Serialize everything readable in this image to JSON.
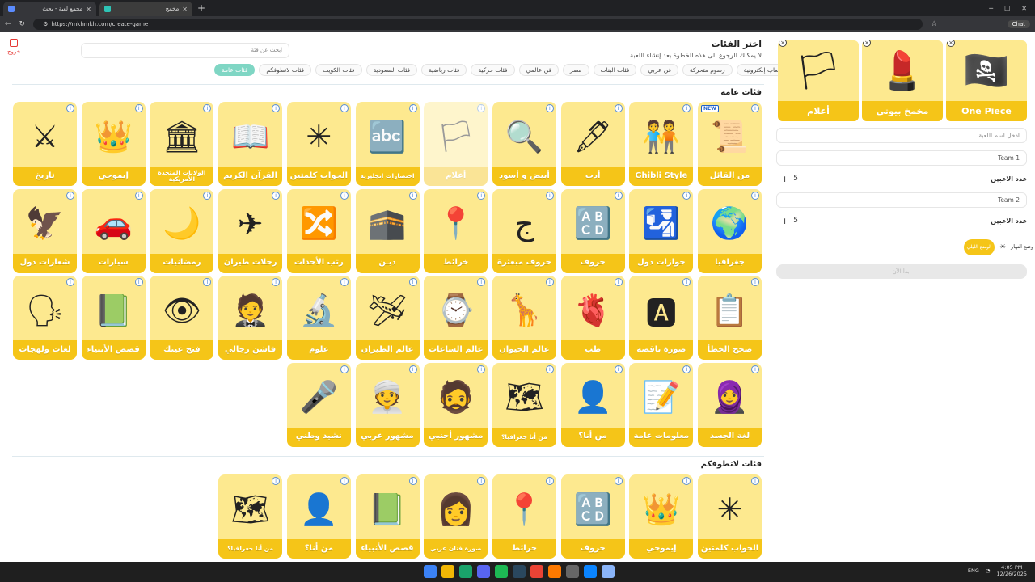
{
  "browser": {
    "tabs": [
      {
        "title": "مجمع لعبة - بحث",
        "active": false
      },
      {
        "title": "مخمخ",
        "active": true
      }
    ],
    "url": "https://mkhmkh.com/create-game",
    "chat_label": "Chat"
  },
  "page": {
    "logout_label": "خروج",
    "search_placeholder": "ابحث عن فئة",
    "heading": "اختر الفئات",
    "subheading": "لا يمكنك الرجوع الى هذه الخطوة بعد إنشاء اللعبة.",
    "chips": [
      {
        "label": "فئات عامة",
        "active": true
      },
      {
        "label": "فئات لاتطوفكم",
        "active": false
      },
      {
        "label": "فئات الكويت",
        "active": false
      },
      {
        "label": "فئات السعودية",
        "active": false
      },
      {
        "label": "فئات رياضية",
        "active": false
      },
      {
        "label": "فئات حركية",
        "active": false
      },
      {
        "label": "فن عالمي",
        "active": false
      },
      {
        "label": "مصر",
        "active": false
      },
      {
        "label": "فئات البنات",
        "active": false
      },
      {
        "label": "فن عربي",
        "active": false
      },
      {
        "label": "رسوم متحركة",
        "active": false
      },
      {
        "label": "العاب إلكترونية",
        "active": false
      }
    ],
    "sections": [
      {
        "title": "فئات عامة",
        "rows": [
          [
            {
              "label": "من القائل",
              "icon": "scroll-icon",
              "glyph": "📜",
              "badge": "NEW"
            },
            {
              "label": "Ghibli Style",
              "icon": "caricature-icon",
              "glyph": "🧑‍🤝‍🧑"
            },
            {
              "label": "أدب",
              "icon": "quill-icon",
              "glyph": "🖋"
            },
            {
              "label": "أبيض و أسود",
              "icon": "magnifier-icon",
              "glyph": "🔍"
            },
            {
              "label": "أعلام",
              "icon": "flags-icon",
              "glyph": "🏳",
              "dim": true
            },
            {
              "label": "اختصارات انجليزية",
              "icon": "letters-icon",
              "glyph": "🔤",
              "small": true
            },
            {
              "label": "الجواب كلمتين",
              "icon": "puzzle-badge-icon",
              "glyph": "✳"
            },
            {
              "label": "القرآن الكريم",
              "icon": "quran-icon",
              "glyph": "📖"
            },
            {
              "label": "الولايات المتحدة الأمريكية",
              "icon": "usa-icon",
              "glyph": "🏛",
              "small": true
            },
            {
              "label": "إيموجي",
              "icon": "emoji-icon",
              "glyph": "👑"
            },
            {
              "label": "تاريخ",
              "icon": "spartan-icon",
              "glyph": "⚔"
            }
          ],
          [
            {
              "label": "جغرافيا",
              "icon": "globe-icon",
              "glyph": "🌍"
            },
            {
              "label": "جوازات دول",
              "icon": "passport-icon",
              "glyph": "🛂"
            },
            {
              "label": "حروف",
              "icon": "letter-grid-icon",
              "glyph": "🔠"
            },
            {
              "label": "حروف مبعثرة",
              "icon": "scattered-letters-icon",
              "glyph": "ج"
            },
            {
              "label": "خرائط",
              "icon": "map-pin-icon",
              "glyph": "📍"
            },
            {
              "label": "ديـن",
              "icon": "kaaba-icon",
              "glyph": "🕋"
            },
            {
              "label": "رتب الأحداث",
              "icon": "sequence-icon",
              "glyph": "🔀"
            },
            {
              "label": "رحلات طيران",
              "icon": "flight-globe-icon",
              "glyph": "✈"
            },
            {
              "label": "رمضانيات",
              "icon": "lantern-icon",
              "glyph": "🌙"
            },
            {
              "label": "سيارات",
              "icon": "car-icon",
              "glyph": "🚗"
            },
            {
              "label": "شعارات دول",
              "icon": "emblem-icon",
              "glyph": "🦅"
            }
          ],
          [
            {
              "label": "صحح الخطأ",
              "icon": "board-icon",
              "glyph": "📋"
            },
            {
              "label": "صورة ناقصة",
              "icon": "amazon-logo-icon",
              "glyph": "🅰"
            },
            {
              "label": "طب",
              "icon": "heart-organ-icon",
              "glyph": "🫀"
            },
            {
              "label": "عالم الحيوان",
              "icon": "animals-icon",
              "glyph": "🦒"
            },
            {
              "label": "عالم الساعات",
              "icon": "watch-icon",
              "glyph": "⌚"
            },
            {
              "label": "عالم الطيران",
              "icon": "cockpit-icon",
              "glyph": "🛩"
            },
            {
              "label": "علوم",
              "icon": "microscope-icon",
              "glyph": "🔬"
            },
            {
              "label": "فاشن رجالي",
              "icon": "suit-icon",
              "glyph": "🤵"
            },
            {
              "label": "فتح عينك",
              "icon": "eye-icon",
              "glyph": "👁"
            },
            {
              "label": "قصص الأنبياء",
              "icon": "story-book-icon",
              "glyph": "📗"
            },
            {
              "label": "لغات ولهجات",
              "icon": "languages-icon",
              "glyph": "🗣"
            }
          ],
          [
            {
              "label": "لغة الجسد",
              "icon": "women-icon",
              "glyph": "🧕"
            },
            {
              "label": "معلومات عامة",
              "icon": "checklist-icon",
              "glyph": "📝"
            },
            {
              "label": "من أنا؟",
              "icon": "person-silhouette-icon",
              "glyph": "👤"
            },
            {
              "label": "من أنا جغرافيا؟",
              "icon": "world-map-icon",
              "glyph": "🗺",
              "small": true
            },
            {
              "label": "مشهور أجنبي",
              "icon": "blurred-face-icon",
              "glyph": "🧔"
            },
            {
              "label": "مشهور عربي",
              "icon": "arab-man-icon",
              "glyph": "👳"
            },
            {
              "label": "نشيد وطني",
              "icon": "choir-icon",
              "glyph": "🎤"
            }
          ]
        ]
      },
      {
        "title": "فئات لاتطوفكم",
        "rows": [
          [
            {
              "label": "الجواب كلمتين",
              "icon": "puzzle-badge-icon",
              "glyph": "✳"
            },
            {
              "label": "إيموجي",
              "icon": "emoji-icon",
              "glyph": "👑"
            },
            {
              "label": "حروف",
              "icon": "letter-grid-icon",
              "glyph": "🔠"
            },
            {
              "label": "خرائط",
              "icon": "map-pin-icon",
              "glyph": "📍"
            },
            {
              "label": "صورة فنان عربي",
              "icon": "artist-face-icon",
              "glyph": "👩",
              "small": true
            },
            {
              "label": "قصص الأنبياء",
              "icon": "story-book-icon",
              "glyph": "📗"
            },
            {
              "label": "من أنا؟",
              "icon": "person-silhouette-icon",
              "glyph": "👤"
            },
            {
              "label": "من أنا جغرافيا؟",
              "icon": "world-map-icon",
              "glyph": "🗺",
              "small": true
            }
          ]
        ]
      }
    ],
    "selected": [
      {
        "label": "One Piece",
        "icon": "anime-icon",
        "glyph": "🏴‍☠️"
      },
      {
        "label": "مخمخ بيوتي",
        "icon": "beauty-icon",
        "glyph": "💄"
      },
      {
        "label": "أعلام",
        "icon": "flags-icon",
        "glyph": "🏳"
      }
    ],
    "game_name_placeholder": "ادخل اسم اللعبة",
    "team1": {
      "name": "Team 1",
      "players_label": "عدد الاعبين",
      "count": "5"
    },
    "team2": {
      "name": "Team 2",
      "players_label": "عدد الاعبين",
      "count": "5"
    },
    "theme_label": "وضع النهار",
    "toggle_label": "الوضع الليلي",
    "start_label": "ابدأ الآن"
  },
  "taskbar": {
    "lang": "ENG",
    "time": "4:05 PM",
    "date": "12/26/2025"
  }
}
